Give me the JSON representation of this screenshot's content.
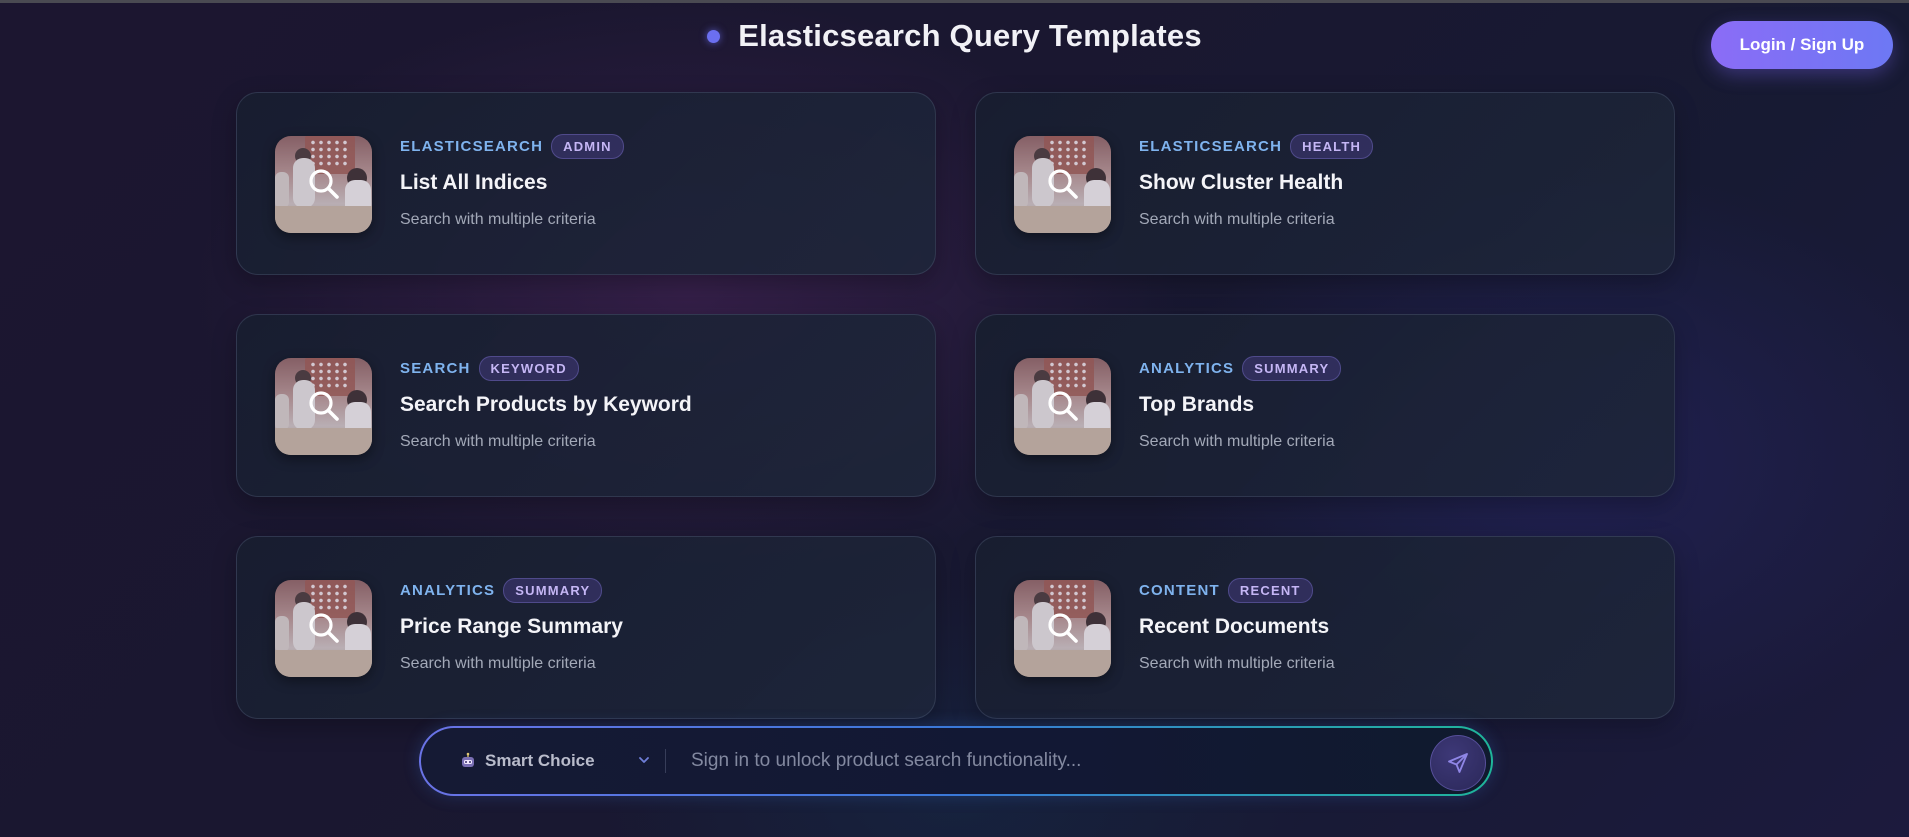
{
  "header": {
    "title": "Elasticsearch Query Templates",
    "login_label": "Login / Sign Up"
  },
  "templates": [
    {
      "category": "ELASTICSEARCH",
      "badge": "ADMIN",
      "title": "List All Indices",
      "description": "Search with multiple criteria"
    },
    {
      "category": "ELASTICSEARCH",
      "badge": "HEALTH",
      "title": "Show Cluster Health",
      "description": "Search with multiple criteria"
    },
    {
      "category": "SEARCH",
      "badge": "KEYWORD",
      "title": "Search Products by Keyword",
      "description": "Search with multiple criteria"
    },
    {
      "category": "ANALYTICS",
      "badge": "SUMMARY",
      "title": "Top Brands",
      "description": "Search with multiple criteria"
    },
    {
      "category": "ANALYTICS",
      "badge": "SUMMARY",
      "title": "Price Range Summary",
      "description": "Search with multiple criteria"
    },
    {
      "category": "CONTENT",
      "badge": "RECENT",
      "title": "Recent Documents",
      "description": "Search with multiple criteria"
    }
  ],
  "searchbar": {
    "model_label": "Smart Choice",
    "model_icon": "robot-icon",
    "placeholder": "Sign in to unlock product search functionality...",
    "send_icon": "send-icon"
  },
  "colors": {
    "accent": "#6b6ff0",
    "login_gradient_start": "#8b6cf6",
    "login_gradient_end": "#6d78f4",
    "category_text": "#7fb3ee",
    "badge_text": "#c5b6f5"
  }
}
